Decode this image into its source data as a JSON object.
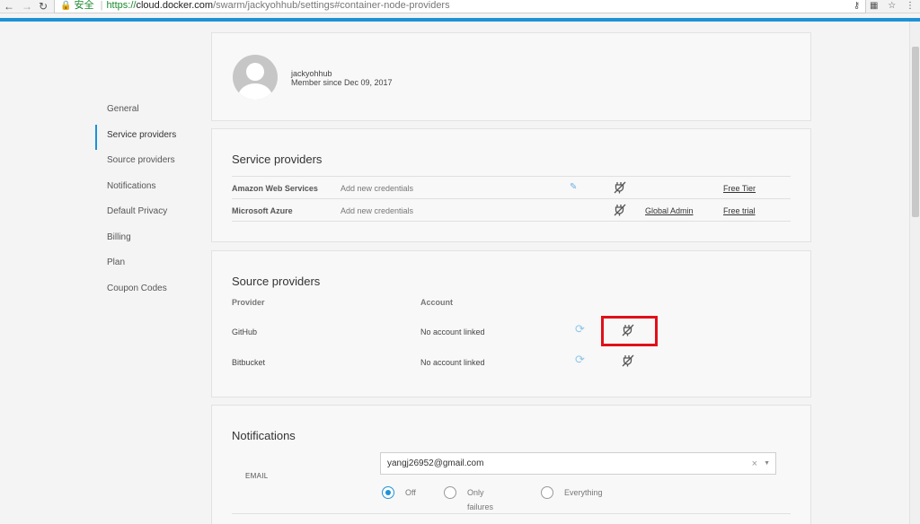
{
  "browser": {
    "url_secure_label": "安全",
    "url_scheme": "https://",
    "url_host": "cloud.docker.com",
    "url_path": "/swarm/jackyohhub/settings#container-node-providers",
    "back_icon": "arrow-left-icon",
    "forward_icon": "arrow-right-icon",
    "reload_icon": "reload-icon"
  },
  "colors": {
    "accent": "#1d92d8",
    "highlight": "#e0101a"
  },
  "sidebar": {
    "items": [
      {
        "label": "General"
      },
      {
        "label": "Service providers",
        "active": true
      },
      {
        "label": "Source providers"
      },
      {
        "label": "Notifications"
      },
      {
        "label": "Default Privacy"
      },
      {
        "label": "Billing"
      },
      {
        "label": "Plan"
      },
      {
        "label": "Coupon Codes"
      }
    ]
  },
  "profile": {
    "username": "jackyohhub",
    "member_since": "Member since Dec 09, 2017"
  },
  "service_providers": {
    "title": "Service providers",
    "rows": [
      {
        "provider": "Amazon Web Services",
        "credentials": "Add new credentials",
        "plan_link": "Free Tier"
      },
      {
        "provider": "Microsoft Azure",
        "credentials": "Add new credentials",
        "admin_link": "Global Admin",
        "plan_link": "Free trial"
      }
    ]
  },
  "source_providers": {
    "title": "Source providers",
    "col_provider": "Provider",
    "col_account": "Account",
    "rows": [
      {
        "provider": "GitHub",
        "account": "No account linked"
      },
      {
        "provider": "Bitbucket",
        "account": "No account linked"
      }
    ]
  },
  "notifications": {
    "title": "Notifications",
    "email_label": "EMAIL",
    "email_value": "yangj26952@gmail.com",
    "options": [
      {
        "label": "Off",
        "checked": true
      },
      {
        "label": "Only failures",
        "checked": false
      },
      {
        "label": "Everything",
        "checked": false
      }
    ]
  }
}
